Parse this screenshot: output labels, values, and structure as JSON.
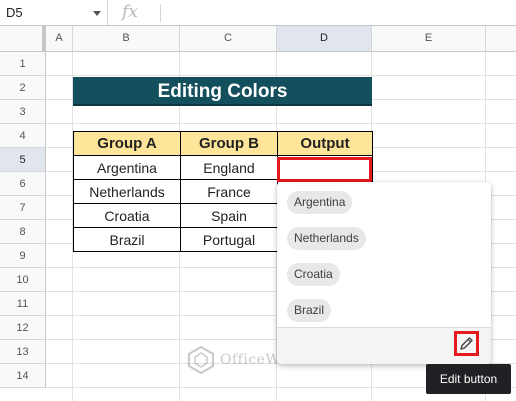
{
  "formula_bar": {
    "name_box": "D5",
    "fx_label": "fx"
  },
  "columns": [
    "A",
    "B",
    "C",
    "D",
    "E"
  ],
  "selected_column": "D",
  "rows": [
    "1",
    "2",
    "3",
    "4",
    "5",
    "6",
    "7",
    "8",
    "9",
    "10",
    "11",
    "12",
    "13",
    "14"
  ],
  "selected_row": "5",
  "title": "Editing Colors",
  "table": {
    "headers": [
      "Group A",
      "Group B",
      "Output"
    ],
    "rows": [
      [
        "Argentina",
        "England",
        ""
      ],
      [
        "Netherlands",
        "France",
        ""
      ],
      [
        "Croatia",
        "Spain",
        ""
      ],
      [
        "Brazil",
        "Portugal",
        ""
      ]
    ]
  },
  "dropdown": {
    "options": [
      "Argentina",
      "Netherlands",
      "Croatia",
      "Brazil"
    ],
    "edit_icon": "pencil-icon"
  },
  "tooltip": "Edit button",
  "watermark": "OfficeWheel",
  "colors": {
    "title_bg": "#134f5c",
    "header_bg": "#ffe599",
    "highlight": "#e5191e",
    "chip_bg": "#e8e8e8",
    "tooltip_bg": "#202124"
  }
}
